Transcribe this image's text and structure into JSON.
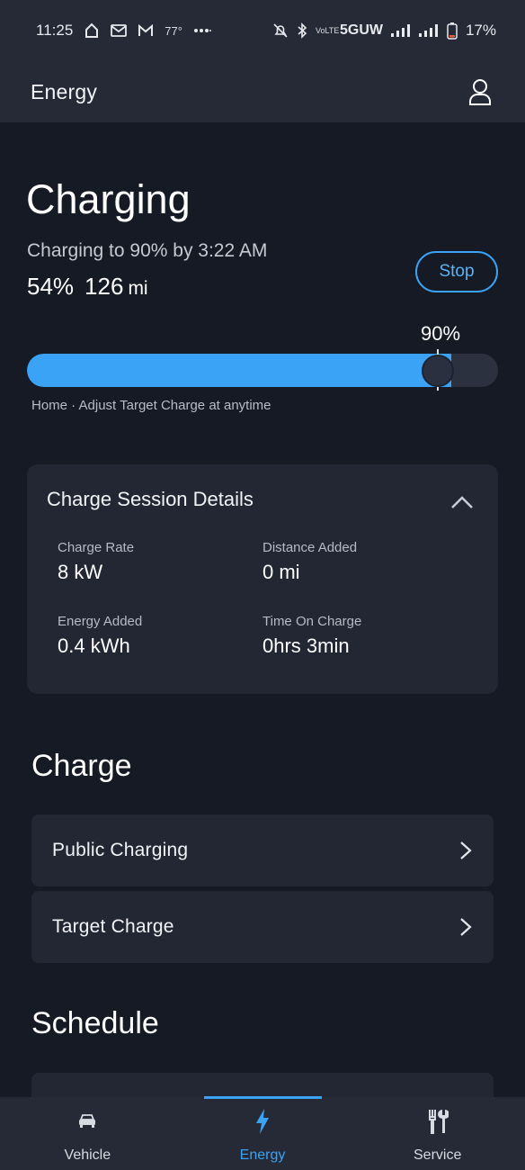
{
  "status_bar": {
    "time": "11:25",
    "temperature": "77°",
    "network_lte": "VoLTE",
    "network": "5GUW",
    "battery": "17%"
  },
  "header": {
    "title": "Energy",
    "profile_icon": "user-icon"
  },
  "charging": {
    "title": "Charging",
    "status_text": "Charging to 90% by 3:22 AM",
    "state_of_charge": "54%",
    "range_value": "126",
    "range_unit": "mi",
    "stop_label": "Stop",
    "target_label": "90%",
    "current_level_fraction": 0.54,
    "target_level_fraction": 0.9,
    "hint": "Home · Adjust Target Charge at anytime",
    "accent_color": "#3aa3f5"
  },
  "session_details": {
    "title": "Charge Session Details",
    "charge_rate_label": "Charge Rate",
    "charge_rate_value": "8 kW",
    "distance_added_label": "Distance Added",
    "distance_added_value": "0 mi",
    "energy_added_label": "Energy Added",
    "energy_added_value": "0.4 kWh",
    "time_on_charge_label": "Time On Charge",
    "time_on_charge_value": "0hrs 3min"
  },
  "charge_section": {
    "title": "Charge",
    "items": [
      {
        "label": "Public Charging"
      },
      {
        "label": "Target Charge"
      }
    ]
  },
  "schedule_section": {
    "title": "Schedule"
  },
  "bottom_nav": {
    "tabs": [
      {
        "label": "Vehicle",
        "icon": "car-icon"
      },
      {
        "label": "Energy",
        "icon": "lightning-icon",
        "active": true
      },
      {
        "label": "Service",
        "icon": "tools-icon"
      }
    ]
  }
}
